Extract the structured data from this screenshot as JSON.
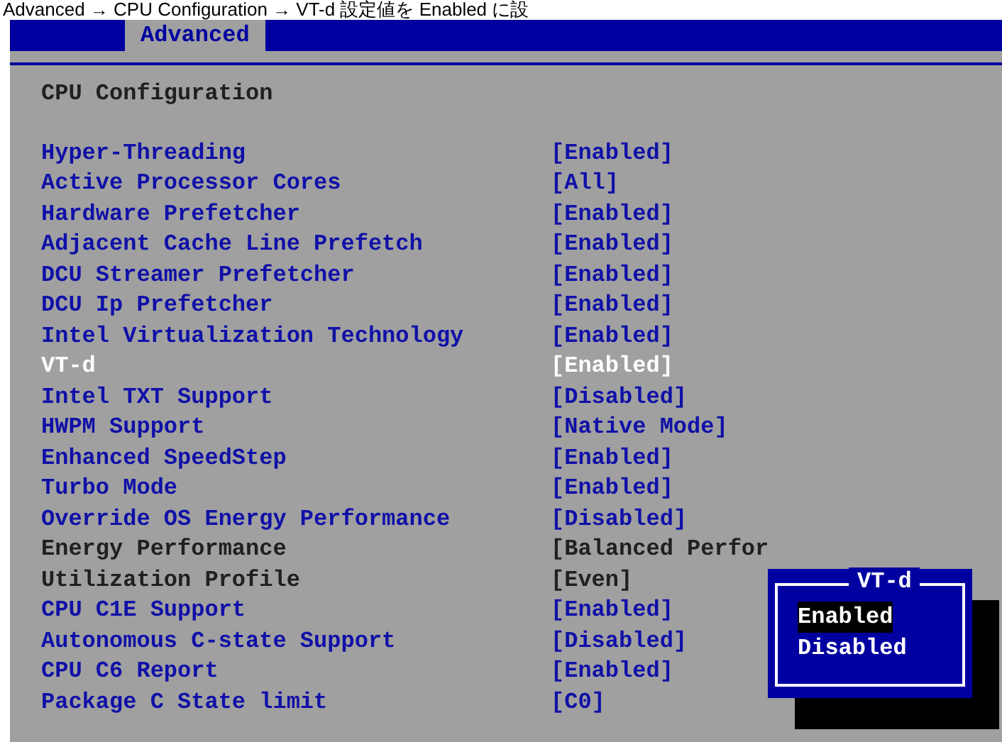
{
  "caption": "Advanced → CPU Configuration → VT-d 設定値を Enabled に設",
  "tabs": [
    {
      "label": "Advanced",
      "selected": true
    }
  ],
  "section_title": "CPU Configuration",
  "settings": [
    {
      "label": "Hyper-Threading",
      "value": "[Enabled]",
      "selected": false,
      "disabled": false
    },
    {
      "label": "Active Processor Cores",
      "value": "[All]",
      "selected": false,
      "disabled": false
    },
    {
      "label": "Hardware Prefetcher",
      "value": "[Enabled]",
      "selected": false,
      "disabled": false
    },
    {
      "label": "Adjacent Cache Line Prefetch",
      "value": "[Enabled]",
      "selected": false,
      "disabled": false
    },
    {
      "label": "DCU Streamer Prefetcher",
      "value": "[Enabled]",
      "selected": false,
      "disabled": false
    },
    {
      "label": "DCU Ip Prefetcher",
      "value": "[Enabled]",
      "selected": false,
      "disabled": false
    },
    {
      "label": "Intel Virtualization Technology",
      "value": "[Enabled]",
      "selected": false,
      "disabled": false
    },
    {
      "label": "VT-d",
      "value": "[Enabled]",
      "selected": true,
      "disabled": false
    },
    {
      "label": "Intel TXT Support",
      "value": "[Disabled]",
      "selected": false,
      "disabled": false
    },
    {
      "label": "HWPM Support",
      "value": "[Native Mode]",
      "selected": false,
      "disabled": false
    },
    {
      "label": "Enhanced SpeedStep",
      "value": "[Enabled]",
      "selected": false,
      "disabled": false
    },
    {
      "label": "Turbo Mode",
      "value": "[Enabled]",
      "selected": false,
      "disabled": false
    },
    {
      "label": "Override OS Energy Performance",
      "value": "[Disabled]",
      "selected": false,
      "disabled": false
    },
    {
      "label": "Energy Performance",
      "value": "[Balanced Perfor",
      "selected": false,
      "disabled": true
    },
    {
      "label": "Utilization Profile",
      "value": "[Even]",
      "selected": false,
      "disabled": true
    },
    {
      "label": "CPU C1E Support",
      "value": "[Enabled]",
      "selected": false,
      "disabled": false
    },
    {
      "label": "Autonomous C-state Support",
      "value": "[Disabled]",
      "selected": false,
      "disabled": false
    },
    {
      "label": "CPU C6 Report",
      "value": "[Enabled]",
      "selected": false,
      "disabled": false
    },
    {
      "label": "Package C State limit",
      "value": "[C0]",
      "selected": false,
      "disabled": false
    }
  ],
  "popup": {
    "title": "VT-d",
    "options": [
      {
        "label": "Enabled",
        "selected": true
      },
      {
        "label": "Disabled",
        "selected": false
      }
    ]
  }
}
